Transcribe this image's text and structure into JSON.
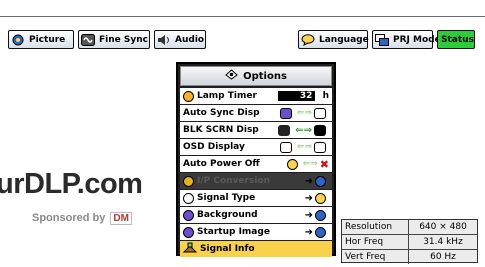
{
  "menu": {
    "picture": "Picture",
    "fine_sync": "Fine Sync",
    "audio": "Audio",
    "language": "Language",
    "prj_mode": "PRJ Mode",
    "status": "Status"
  },
  "options": {
    "title": "Options",
    "items": [
      {
        "label": "Lamp Timer",
        "value": "32",
        "unit": "h"
      },
      {
        "label": "Auto Sync Disp"
      },
      {
        "label": "BLK SCRN Disp"
      },
      {
        "label": "OSD Display"
      },
      {
        "label": "Auto Power Off"
      },
      {
        "label": "I/P Conversion"
      },
      {
        "label": "Signal Type"
      },
      {
        "label": "Background"
      },
      {
        "label": "Startup Image"
      },
      {
        "label": "Signal Info"
      }
    ]
  },
  "signal_info": {
    "rows": [
      {
        "key": "Resolution",
        "value": "640 × 480"
      },
      {
        "key": "Hor Freq",
        "value": "31.4 kHz"
      },
      {
        "key": "Vert Freq",
        "value": "60  Hz"
      }
    ]
  },
  "watermark": {
    "text": "urDLP.com",
    "sponsor": "Sponsored by",
    "sponsor_logo": "DM"
  },
  "colors": {
    "active_tab": "#2dcc3a",
    "selected_row": "#f7d24a",
    "panel_bg": "#1e1e1e"
  }
}
